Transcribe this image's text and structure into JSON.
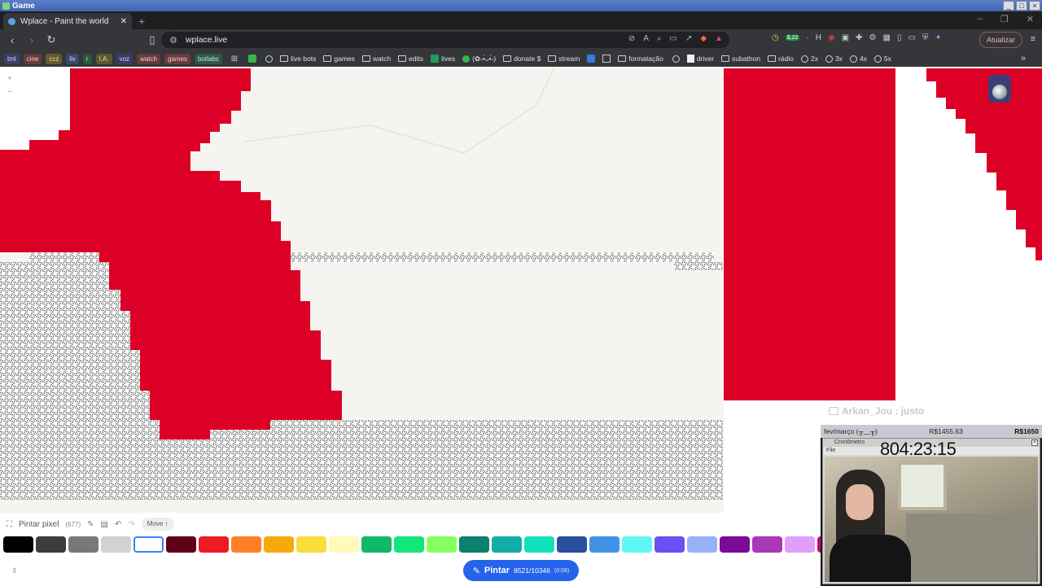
{
  "os": {
    "title": "Game"
  },
  "tab": {
    "title": "Wplace - Paint the world"
  },
  "address": {
    "url": "wplace.live",
    "balance": "$,22",
    "update_label": "Atualizar"
  },
  "bookmarks": {
    "chips": [
      "tml",
      "cine",
      "ccz",
      "liv",
      "r",
      "I.A.",
      "voz",
      "watch",
      "games",
      "botlabs"
    ],
    "items": [
      "live bots",
      "games",
      "watch",
      "edits",
      "lives",
      "(✿˵•̀ᴗ•́˵)",
      "donate $",
      "stream",
      "formatação",
      "driver",
      "subathon",
      "rádio",
      "2x",
      "3x",
      "4x",
      "5x"
    ]
  },
  "toolbar": {
    "paint_label": "Pintar pixel",
    "paint_count": "(677)",
    "move_label": "Move ↑"
  },
  "palette": {
    "colors": [
      "#000000",
      "#3c3c3c",
      "#787878",
      "#d2d2d2",
      "#ffffff",
      "#600018",
      "#ed1c24",
      "#ff7f27",
      "#f6aa09",
      "#f9dd3b",
      "#fffabc",
      "#0eb968",
      "#13e67b",
      "#87ff5e",
      "#0c816e",
      "#10aea6",
      "#13e1be",
      "#28509e",
      "#4093e4",
      "#60f7f2",
      "#6b50f6",
      "#99b1fb",
      "#780c99",
      "#aa38b9",
      "#e09ff9",
      "#cb007a"
    ],
    "selected_index": 4
  },
  "pintar": {
    "label": "Pintar",
    "count": "8521/10346",
    "timer": "(0:08)"
  },
  "chat": {
    "text": "Arkan_Jou : justo"
  },
  "stream": {
    "goal_left": "fev/março (╥﹏╥)",
    "goal_mid": "R$1455.63",
    "goal_right": "R$1650",
    "subwin_title": "Cronômetro",
    "subwin_menu": "File",
    "timer": "804:23:15"
  },
  "colors": {
    "red": "#dc0026",
    "canvas": "#f6f4f0",
    "accent": "#2563eb"
  }
}
